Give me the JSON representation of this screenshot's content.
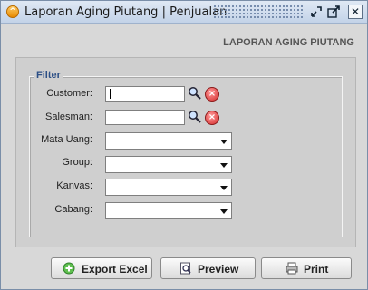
{
  "window": {
    "title": "Laporan Aging Piutang | Penjualan",
    "buttons": [
      "minimize",
      "maximize",
      "close"
    ]
  },
  "report_title": "LAPORAN AGING PIUTANG",
  "filter": {
    "legend": "Filter",
    "customer": {
      "label": "Customer:",
      "value": ""
    },
    "salesman": {
      "label": "Salesman:",
      "value": ""
    },
    "mata_uang": {
      "label": "Mata Uang:",
      "value": ""
    },
    "group": {
      "label": "Group:",
      "value": ""
    },
    "kanvas": {
      "label": "Kanvas:",
      "value": ""
    },
    "cabang": {
      "label": "Cabang:",
      "value": ""
    }
  },
  "actions": {
    "export_excel": "Export Excel",
    "preview": "Preview",
    "print": "Print"
  },
  "colors": {
    "legend": "#2c4f86",
    "title_gradient_top": "#dfe8f4",
    "title_gradient_bottom": "#c3d3e8"
  }
}
